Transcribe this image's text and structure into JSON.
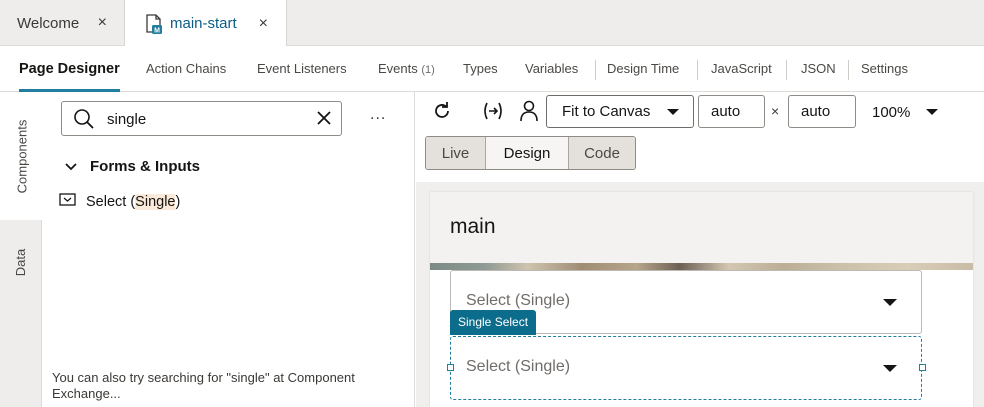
{
  "file_tabs": [
    {
      "label": "Welcome",
      "close": "×"
    },
    {
      "label": "main-start",
      "close": "×"
    }
  ],
  "designer_tabs": {
    "page_designer": "Page Designer",
    "action_chains": "Action Chains",
    "event_listeners": "Event Listeners",
    "events": "Events",
    "events_count": "(1)",
    "types": "Types",
    "variables": "Variables",
    "design_time": "Design Time",
    "javascript": "JavaScript",
    "json": "JSON",
    "settings": "Settings"
  },
  "rail": {
    "components": "Components",
    "data": "Data"
  },
  "panel": {
    "search_value": "single",
    "more": "...",
    "group_title": "Forms & Inputs",
    "item_prefix": "Select (",
    "item_match": "Single",
    "item_suffix": ")",
    "hint": "You can also try searching for \"single\" at Component Exchange..."
  },
  "toolbar": {
    "fit": "Fit to Canvas",
    "width": "auto",
    "times": "×",
    "height": "auto",
    "zoom": "100%",
    "modes": [
      "Live",
      "Design",
      "Code"
    ],
    "selected_mode": "Design"
  },
  "canvas": {
    "page_title": "main",
    "select1_placeholder": "Select (Single)",
    "badge": "Single Select",
    "select2_placeholder": "Select (Single)"
  },
  "colors": {
    "accent": "#227e9e",
    "badge": "#0c6c8b",
    "highlight": "#fbe9d9"
  }
}
